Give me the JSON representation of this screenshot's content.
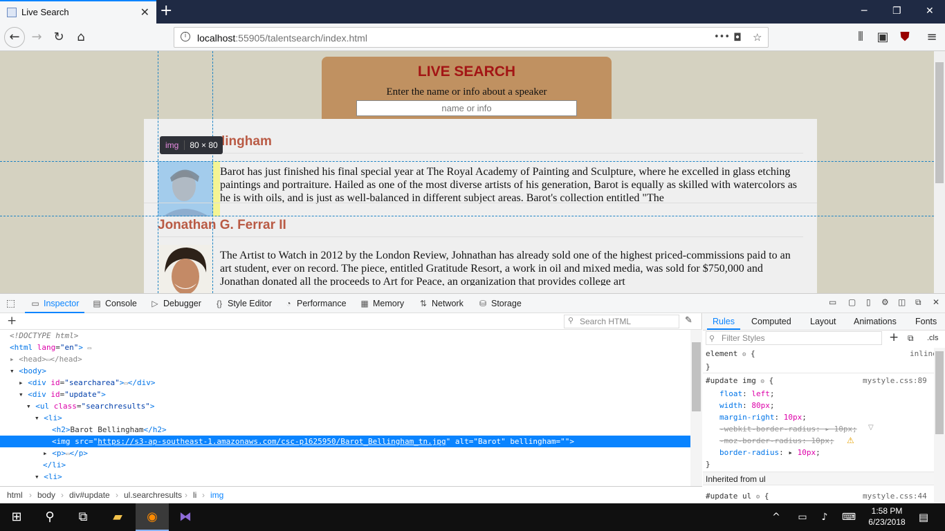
{
  "browser": {
    "tab_title": "Live Search",
    "new_tab": "+",
    "url_host": "localhost",
    "url_rest": ":55905/talentsearch/index.html",
    "url_more": "•••",
    "window": {
      "minimize": "─",
      "restore": "❐",
      "close": "✕"
    }
  },
  "page": {
    "heading": "LIVE SEARCH",
    "subheading": "Enter the name or info about a speaker",
    "search_placeholder": "name or info",
    "results": [
      {
        "name_visible": "lingham",
        "bio": "Barot has just finished his final special year at The Royal Academy of Painting and Sculpture, where he excelled in glass etching paintings and portraiture. Hailed as one of the most diverse artists of his generation, Barot is equally as skilled with watercolors as he is with oils, and is just as well-balanced in different subject areas. Barot's collection entitled \"The"
      },
      {
        "name_visible": "Jonathan G. Ferrar II",
        "bio": "The Artist to Watch in 2012 by the London Review, Johnathan has already sold one of the highest priced-commissions paid to an art student, ever on record. The piece, entitled Gratitude Resort, a work in oil and mixed media, was sold for $750,000 and Jonathan donated all the proceeds to Art for Peace, an organization that provides college art"
      }
    ],
    "tooltip_tag": "img",
    "tooltip_dims": "80 × 80"
  },
  "devtools": {
    "tabs": [
      "Inspector",
      "Console",
      "Debugger",
      "Style Editor",
      "Performance",
      "Memory",
      "Network",
      "Storage"
    ],
    "search_html_placeholder": "Search HTML",
    "breadcrumbs": [
      "html",
      "body",
      "div#update",
      "ul.searchresults",
      "li",
      "img"
    ],
    "rules_tabs": [
      "Rules",
      "Computed",
      "Layout",
      "Animations",
      "Fonts"
    ],
    "filter_placeholder": "Filter Styles",
    "cls_label": ".cls",
    "inherited_label": "Inherited from ul",
    "inline_label": "inline",
    "source_update_img": "mystyle.css:89",
    "source_update_ul": "mystyle.css:44"
  },
  "taskbar": {
    "time": "1:58 PM",
    "date": "6/23/2018"
  }
}
